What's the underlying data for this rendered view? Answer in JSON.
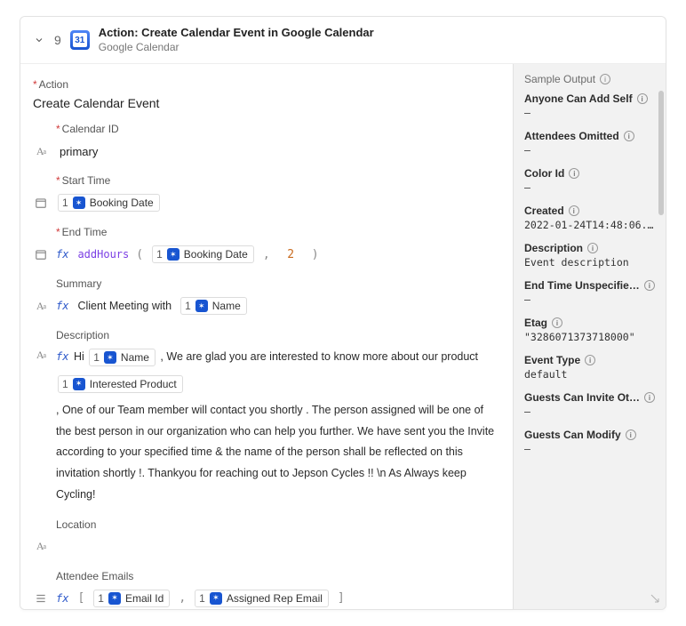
{
  "header": {
    "step": "9",
    "title": "Action: Create Calendar Event in Google Calendar",
    "subtitle": "Google Calendar",
    "app_icon_text": "31"
  },
  "fields": {
    "action_label": "Action",
    "action_value": "Create Calendar Event",
    "calendar_id_label": "Calendar ID",
    "calendar_id_value": "primary",
    "start_time_label": "Start Time",
    "end_time_label": "End Time",
    "end_time_fn": "addHours",
    "end_time_arg2": "2",
    "summary_label": "Summary",
    "summary_prefix": "Client Meeting with",
    "description_label": "Description",
    "desc_hi": "Hi",
    "desc_part1": ", We are glad you are interested to know more about our product",
    "desc_part2": ", One of our Team member will contact you shortly . The person assigned will be one of the best person in our organization who can help you further. We have sent you the Invite according to your specified time & the name of the person shall be reflected on this invitation shortly !. Thankyou for reaching out to Jepson Cycles !! \\n As Always keep Cycling!",
    "location_label": "Location",
    "attendee_label": "Attendee Emails"
  },
  "chips": {
    "booking_date": "Booking Date",
    "name": "Name",
    "interested_product": "Interested Product",
    "email_id": "Email Id",
    "assigned_rep_email": "Assigned Rep Email",
    "one": "1"
  },
  "sample_output": {
    "title": "Sample Output",
    "items": [
      {
        "key": "Anyone Can Add Self",
        "val": "–"
      },
      {
        "key": "Attendees Omitted",
        "val": "–"
      },
      {
        "key": "Color Id",
        "val": "–"
      },
      {
        "key": "Created",
        "val": "2022-01-24T14:48:06.00…"
      },
      {
        "key": "Description",
        "val": "Event description"
      },
      {
        "key": "End Time Unspecifie…",
        "val": "–"
      },
      {
        "key": "Etag",
        "val": "\"3286071373718000\""
      },
      {
        "key": "Event Type",
        "val": "default"
      },
      {
        "key": "Guests Can Invite Ot…",
        "val": "–"
      },
      {
        "key": "Guests Can Modify",
        "val": "–"
      }
    ]
  }
}
